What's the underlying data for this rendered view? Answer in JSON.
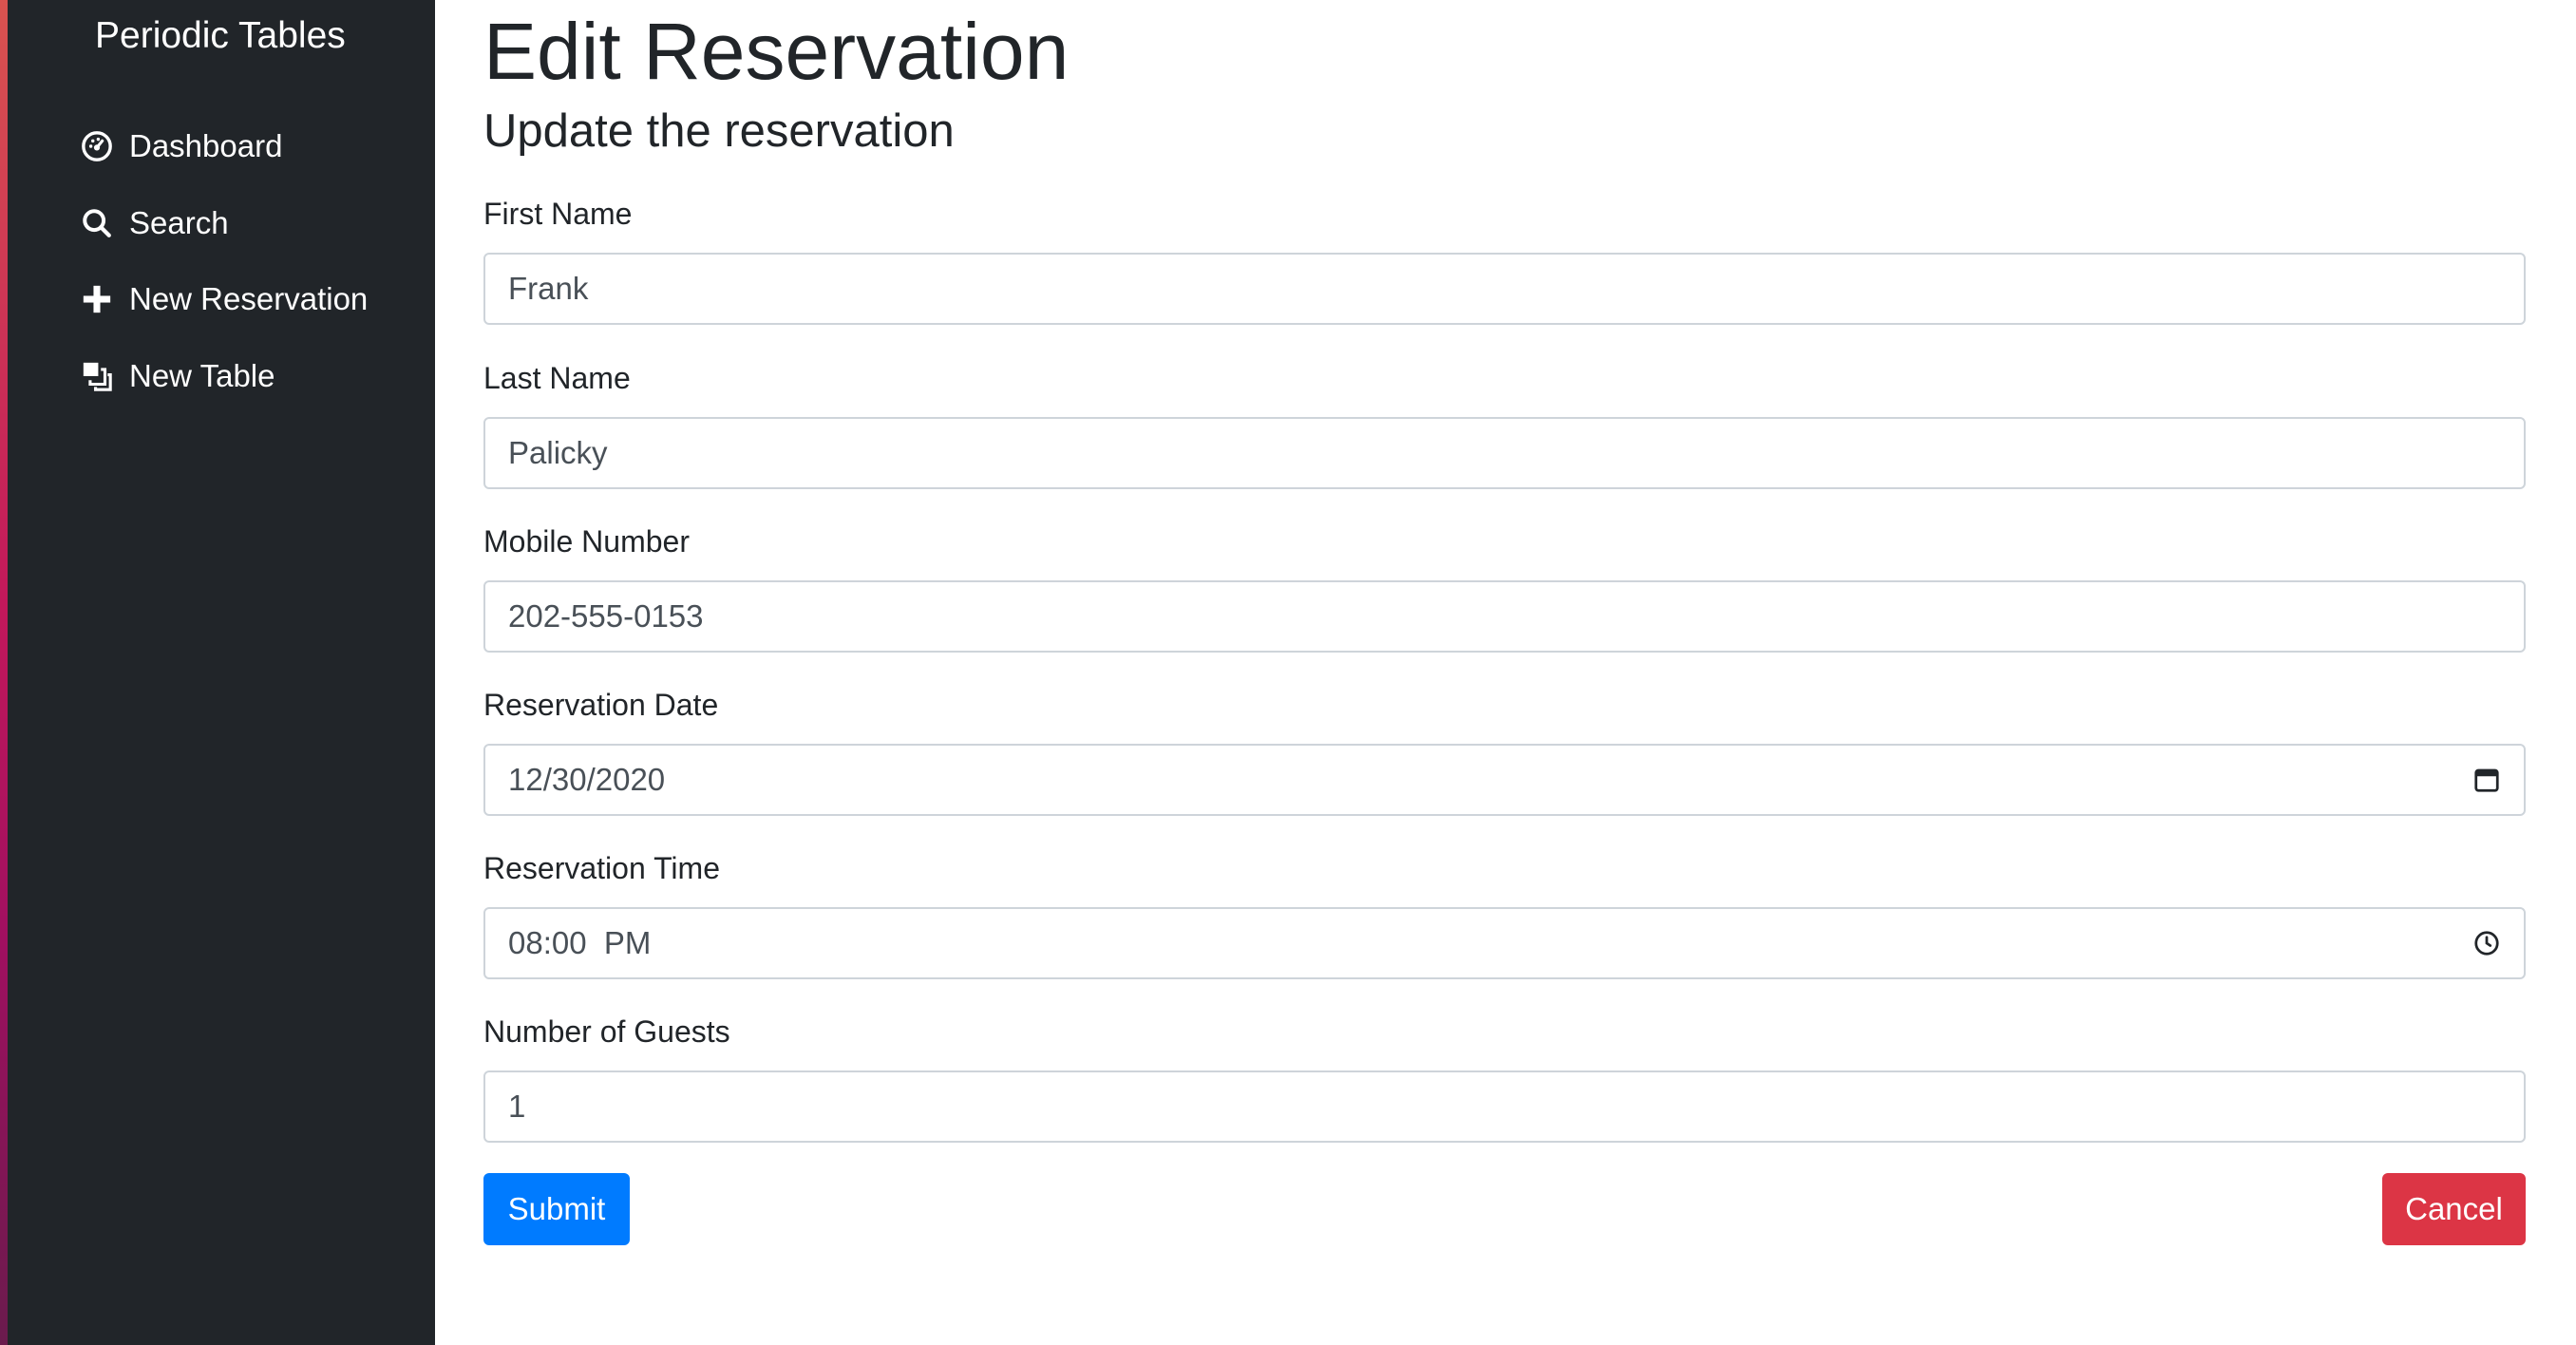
{
  "app": {
    "brand": "Periodic Tables"
  },
  "sidebar": {
    "items": [
      {
        "label": "Dashboard",
        "icon": "dashboard-icon"
      },
      {
        "label": "Search",
        "icon": "search-icon"
      },
      {
        "label": "New Reservation",
        "icon": "plus-icon"
      },
      {
        "label": "New Table",
        "icon": "layers-icon"
      }
    ]
  },
  "page": {
    "title": "Edit Reservation",
    "subtitle": "Update the reservation"
  },
  "form": {
    "first_name": {
      "label": "First Name",
      "value": "Frank"
    },
    "last_name": {
      "label": "Last Name",
      "value": "Palicky"
    },
    "mobile_number": {
      "label": "Mobile Number",
      "value": "202-555-0153"
    },
    "reservation_date": {
      "label": "Reservation Date",
      "value": "12/30/2020",
      "icon": "calendar-icon"
    },
    "reservation_time": {
      "label": "Reservation Time",
      "value": "08:00  PM",
      "icon": "clock-icon"
    },
    "people": {
      "label": "Number of Guests",
      "value": "1"
    },
    "submit_label": "Submit",
    "cancel_label": "Cancel"
  },
  "colors": {
    "sidebar_bg": "#212529",
    "primary": "#007bff",
    "danger": "#dc3545"
  }
}
